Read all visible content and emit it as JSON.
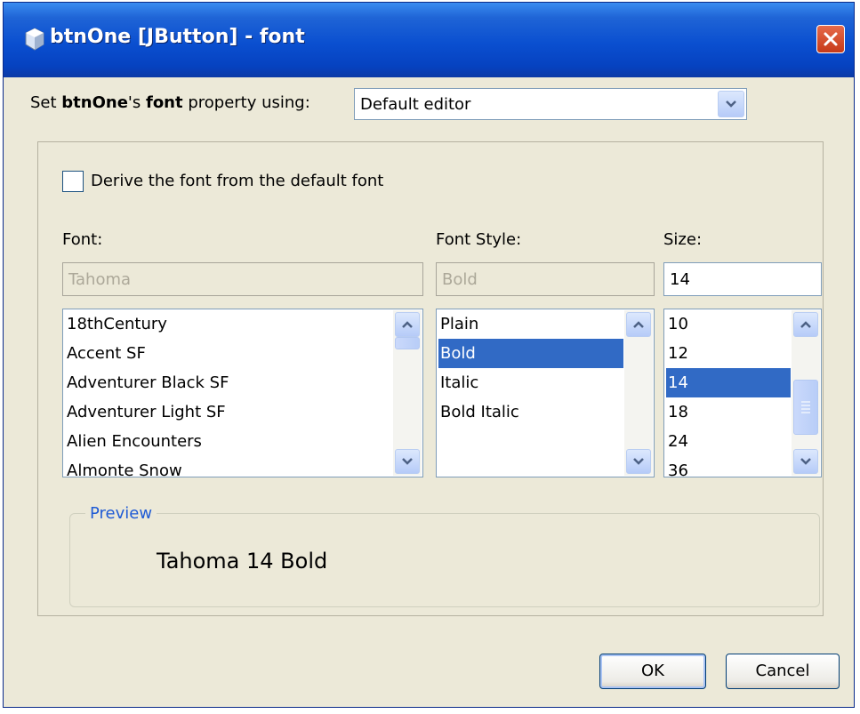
{
  "window": {
    "title": "btnOne [JButton] - font"
  },
  "header": {
    "prefix": "Set ",
    "component": "btnOne",
    "possessive": "'s ",
    "property": "font",
    "suffix": " property using:",
    "editor_value": "Default editor"
  },
  "derive": {
    "label": "Derive the font from the default font",
    "checked": false
  },
  "font": {
    "label": "Font:",
    "value": "Tahoma",
    "items": [
      "18thCentury",
      "Accent SF",
      "Adventurer Black SF",
      "Adventurer Light SF",
      "Alien Encounters",
      "Almonte Snow"
    ]
  },
  "style": {
    "label": "Font Style:",
    "value": "Bold",
    "items": [
      "Plain",
      "Bold",
      "Italic",
      "Bold Italic"
    ],
    "selected": "Bold"
  },
  "size": {
    "label": "Size:",
    "value": "14",
    "items": [
      "10",
      "12",
      "14",
      "18",
      "24",
      "36"
    ],
    "selected": "14"
  },
  "preview": {
    "legend": "Preview",
    "text": "Tahoma 14 Bold"
  },
  "buttons": {
    "ok": "OK",
    "cancel": "Cancel"
  },
  "colors": {
    "title_bar": "#0a4fd0",
    "selection": "#316ac5",
    "window_bg": "#ece9d8",
    "close": "#d64a27"
  }
}
